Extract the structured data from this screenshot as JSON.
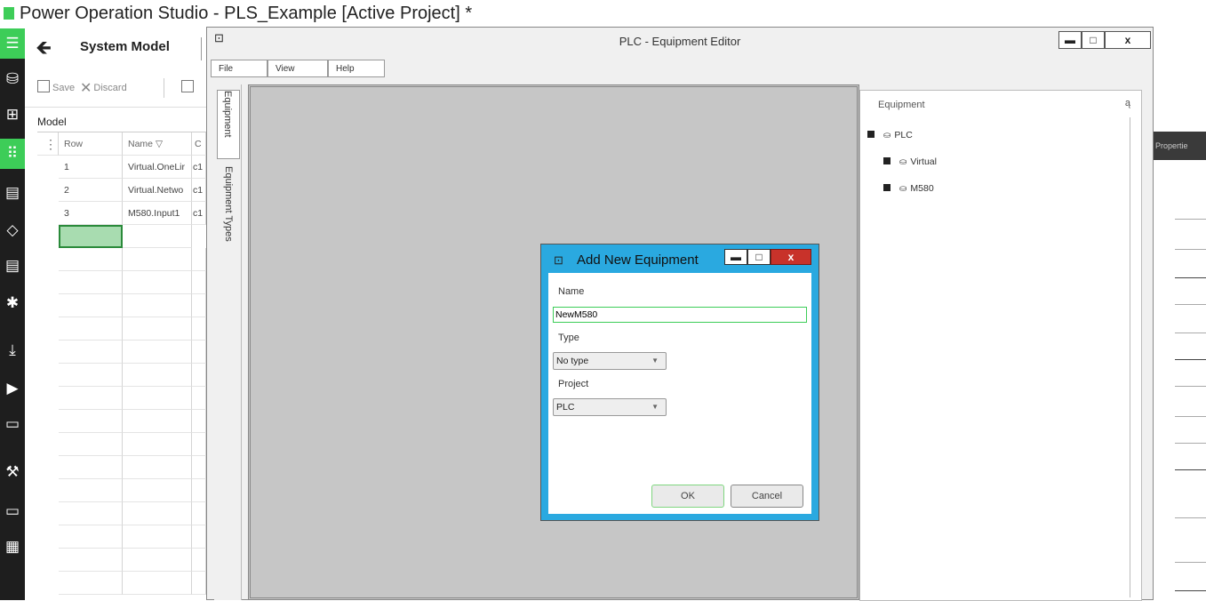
{
  "app": {
    "title": "Power Operation Studio - PLS_Example [Active Project] *"
  },
  "system_model": {
    "title": "System Model",
    "toolbar": {
      "save_label": "Save",
      "discard_label": "Discard"
    },
    "model_label": "Model",
    "columns": [
      "Row",
      "Name",
      "C"
    ],
    "rows": [
      {
        "row": "1",
        "name": "Virtual.OneLir",
        "c": "c1"
      },
      {
        "row": "2",
        "name": "Virtual.Netwo",
        "c": "c1"
      },
      {
        "row": "3",
        "name": "M580.Input1",
        "c": "c1"
      }
    ]
  },
  "right_panel": {
    "properties_label": "Propertie"
  },
  "editor": {
    "title": "PLC - Equipment Editor",
    "window_buttons": {
      "minimize": "▬",
      "maximize": "□",
      "close": "x"
    },
    "menu": [
      "File",
      "View",
      "Help"
    ],
    "vertical_tabs": [
      "Equipment",
      "Equipment Types"
    ],
    "equipment_panel": {
      "header": "Equipment",
      "pin": "ą",
      "tree": [
        {
          "label": "PLC",
          "level": 0
        },
        {
          "label": "Virtual",
          "level": 1
        },
        {
          "label": "M580",
          "level": 1
        }
      ]
    }
  },
  "dialog": {
    "title": "Add New Equipment",
    "window_buttons": {
      "minimize": "▬",
      "maximize": "□",
      "close": "x"
    },
    "name_label": "Name",
    "name_value": "NewM580",
    "type_label": "Type",
    "type_value": "No type",
    "project_label": "Project",
    "project_value": "PLC",
    "ok_label": "OK",
    "cancel_label": "Cancel"
  },
  "colors": {
    "accent_green": "#3dcd58",
    "dialog_border": "#2aa9e0",
    "canvas": "#c6c6c6"
  }
}
